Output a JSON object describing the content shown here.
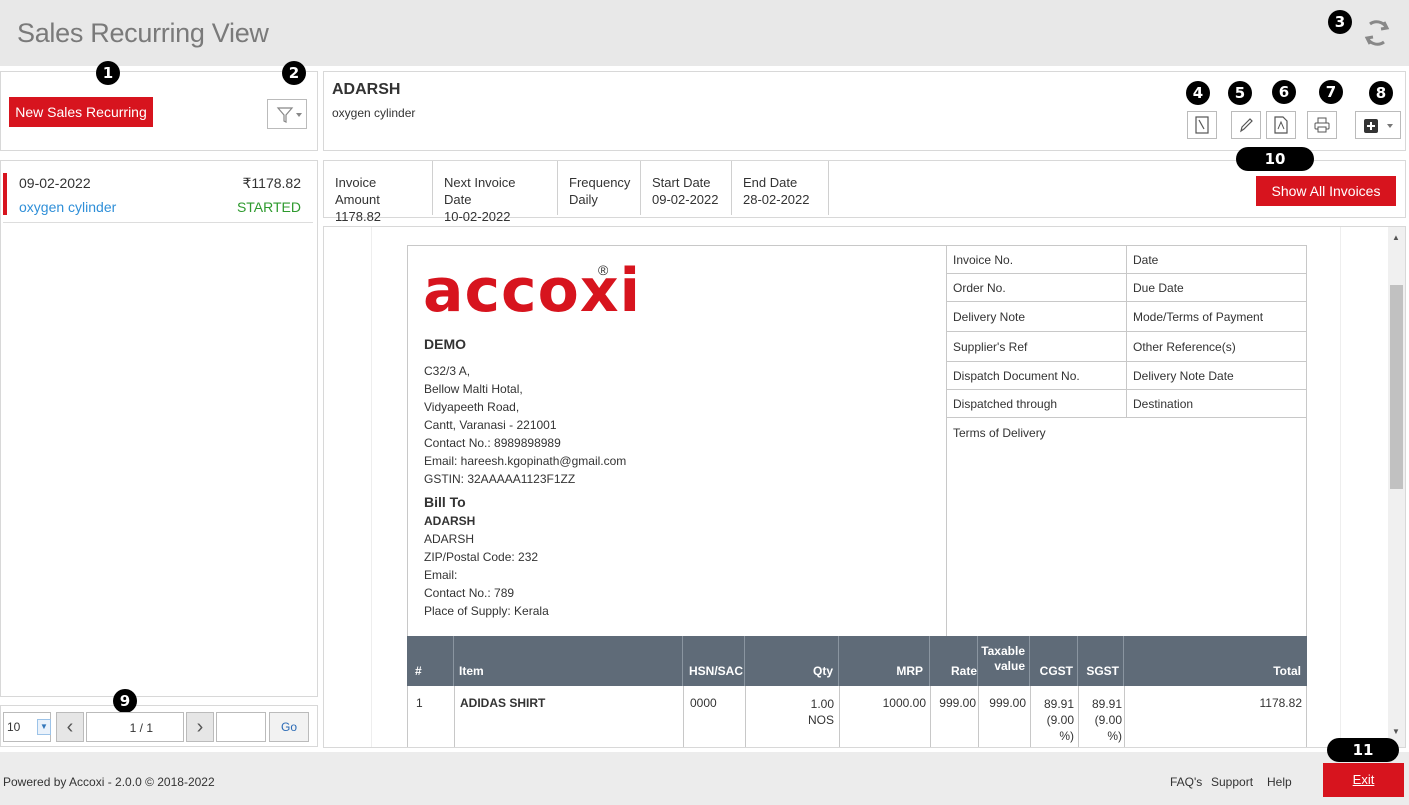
{
  "header": {
    "title": "Sales Recurring View"
  },
  "badges": {
    "b1": "1",
    "b2": "2",
    "b3": "3",
    "b4": "4",
    "b5": "5",
    "b6": "6",
    "b7": "7",
    "b8": "8",
    "b9": "9",
    "b10": "10",
    "b11": "11"
  },
  "left": {
    "new_button": "New Sales Recurring",
    "item": {
      "date": "09-02-2022",
      "amount": "₹1178.82",
      "name": "oxygen cylinder",
      "status": "STARTED"
    },
    "pager": {
      "size": "10",
      "page": "1 / 1",
      "go": "Go",
      "goto_value": ""
    }
  },
  "detail": {
    "customer": "ADARSH",
    "description": "oxygen cylinder",
    "summary": [
      {
        "label": "Invoice Amount",
        "value": "1178.82"
      },
      {
        "label": "Next Invoice Date",
        "value": "10-02-2022"
      },
      {
        "label": "Frequency",
        "value": "Daily"
      },
      {
        "label": "Start Date",
        "value": "09-02-2022"
      },
      {
        "label": "End Date",
        "value": "28-02-2022"
      }
    ],
    "show_all": "Show All Invoices"
  },
  "invoice": {
    "logo": "accoxi",
    "company": "DEMO",
    "address": [
      "C32/3 A,",
      "Bellow Malti Hotal,",
      "Vidyapeeth Road,",
      "Cantt, Varanasi - 221001",
      "Contact No.: 8989898989",
      "Email: hareesh.kgopinath@gmail.com",
      "GSTIN: 32AAAAA1123F1ZZ"
    ],
    "bill_to_label": "Bill To",
    "bill_to_name": "ADARSH",
    "bill_to": [
      "ADARSH",
      "ZIP/Postal Code: 232",
      "Email:",
      "Contact No.: 789",
      "Place of Supply: Kerala"
    ],
    "meta": [
      [
        "Invoice No.",
        "Date"
      ],
      [
        "Order No.",
        "Due Date"
      ],
      [
        "Delivery Note",
        "Mode/Terms of Payment"
      ],
      [
        "Supplier's Ref",
        "Other Reference(s)"
      ],
      [
        "Dispatch Document No.",
        "Delivery Note Date"
      ],
      [
        "Dispatched through",
        "Destination"
      ]
    ],
    "terms_label": "Terms of Delivery",
    "columns": [
      "#",
      "Item",
      "HSN/SAC",
      "Qty",
      "MRP",
      "Rate",
      "Taxable value",
      "CGST",
      "SGST",
      "Total"
    ],
    "row": {
      "num": "1",
      "item": "ADIDAS SHIRT",
      "hsn": "0000",
      "qty": "1.00",
      "unit": "NOS",
      "mrp": "1000.00",
      "rate": "999.00",
      "taxable": "999.00",
      "cgst": "89.91",
      "cgst_pct": "(9.00 %)",
      "sgst": "89.91",
      "sgst_pct": "(9.00 %)",
      "total": "1178.82"
    }
  },
  "footer": {
    "powered": "Powered by Accoxi - 2.0.0 © 2018-2022",
    "faq": "FAQ's",
    "support": "Support",
    "help": "Help",
    "exit": "Exit"
  },
  "colors": {
    "accent": "#d7141e",
    "link": "#2f8fd8",
    "started": "#2e9a2e",
    "table_header": "#5f6b78"
  }
}
